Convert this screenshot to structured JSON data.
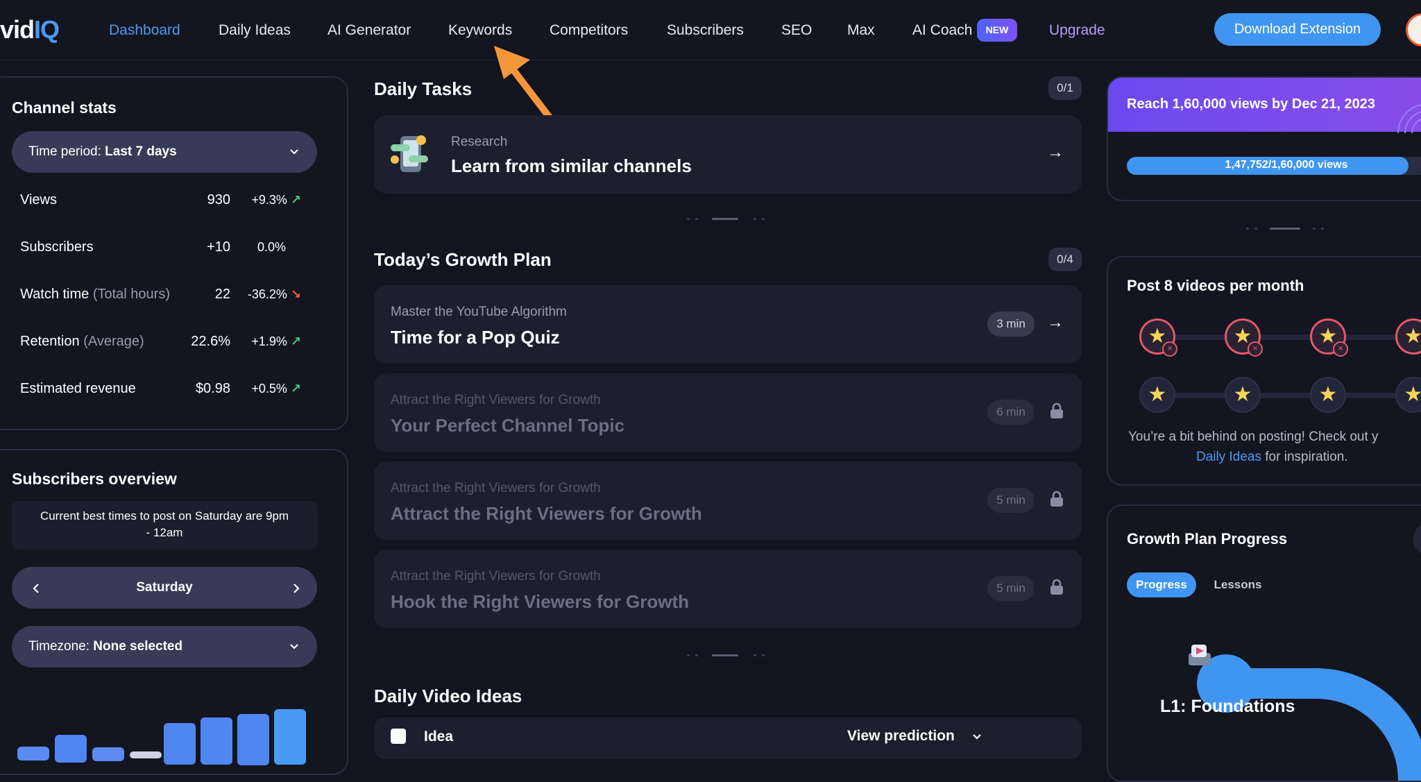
{
  "nav": {
    "logo_prefix": "vid",
    "logo_suffix": "IQ",
    "links": {
      "dashboard": "Dashboard",
      "daily_ideas": "Daily Ideas",
      "ai_generator": "AI Generator",
      "keywords": "Keywords",
      "competitors": "Competitors",
      "subscribers": "Subscribers",
      "seo": "SEO",
      "max": "Max",
      "ai_coach": "AI Coach",
      "upgrade": "Upgrade"
    },
    "new_badge": "NEW",
    "download_extension": "Download Extension",
    "active_tab": "Dashboard"
  },
  "annotation": {
    "arrow_color": "#f5963a"
  },
  "channel_stats": {
    "title": "Channel stats",
    "time_period_label": "Time period:",
    "time_period_value": "Last 7 days",
    "rows": [
      {
        "label": "Views",
        "muted": "",
        "value": "930",
        "change": "+9.3%",
        "trend": "up"
      },
      {
        "label": "Subscribers",
        "muted": "",
        "value": "+10",
        "change": "0.0%",
        "trend": "none"
      },
      {
        "label": "Watch time",
        "muted": "(Total hours)",
        "value": "22",
        "change": "-36.2%",
        "trend": "down"
      },
      {
        "label": "Retention",
        "muted": "(Average)",
        "value": "22.6%",
        "change": "+1.9%",
        "trend": "up"
      },
      {
        "label": "Estimated revenue",
        "muted": "",
        "value": "$0.98",
        "change": "+0.5%",
        "trend": "up"
      }
    ]
  },
  "subscribers_overview": {
    "title": "Subscribers overview",
    "best_times_line1": "Current best times to post on Saturday are 9pm",
    "best_times_line2": "- 12am",
    "day": "Saturday",
    "timezone_label": "Timezone:",
    "timezone_value": "None selected"
  },
  "daily_tasks": {
    "title": "Daily Tasks",
    "counter": "0/1",
    "task": {
      "category": "Research",
      "title": "Learn from similar channels"
    }
  },
  "growth_plan": {
    "title": "Today’s Growth Plan",
    "counter": "0/4",
    "items": [
      {
        "category": "Master the YouTube Algorithm",
        "title": "Time for a Pop Quiz",
        "duration": "3 min",
        "locked": false
      },
      {
        "category": "Attract the Right Viewers for Growth",
        "title": "Your Perfect Channel Topic",
        "duration": "6 min",
        "locked": true
      },
      {
        "category": "Attract the Right Viewers for Growth",
        "title": "Attract the Right Viewers for Growth",
        "duration": "5 min",
        "locked": true
      },
      {
        "category": "Attract the Right Viewers for Growth",
        "title": "Hook the Right Viewers for Growth",
        "duration": "5 min",
        "locked": true
      }
    ]
  },
  "daily_video_ideas": {
    "title": "Daily Video Ideas",
    "col_idea": "Idea",
    "col_prediction": "View prediction"
  },
  "goal": {
    "title": "Reach 1,60,000 views by Dec 21, 2023",
    "progress_text": "1,47,752/1,60,000 views",
    "progress_fraction": 0.923
  },
  "posting": {
    "title": "Post 8 videos per month",
    "message_line1": "You’re a bit behind on posting! Check out y",
    "message_link": "Daily Ideas",
    "message_tail": " for inspiration."
  },
  "growth_progress": {
    "title": "Growth Plan Progress",
    "tab_progress": "Progress",
    "tab_lessons": "Lessons",
    "level": "L1: Foundations"
  }
}
